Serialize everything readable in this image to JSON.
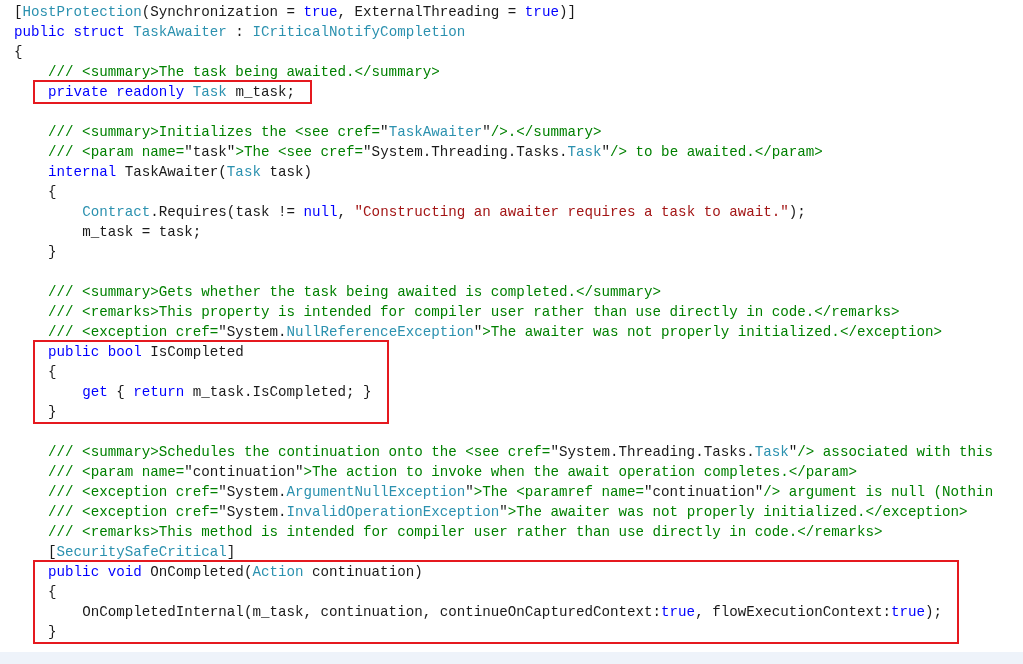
{
  "editor": {
    "blocks": [
      {
        "highlighted": false,
        "blank_line_after": false,
        "lines": [
          [
            {
              "text": "[",
              "kind": "plain"
            },
            {
              "text": "HostProtection",
              "kind": "type"
            },
            {
              "text": "(Synchronization = ",
              "kind": "plain"
            },
            {
              "text": "true",
              "kind": "keyword"
            },
            {
              "text": ", ExternalThreading = ",
              "kind": "plain"
            },
            {
              "text": "true",
              "kind": "keyword"
            },
            {
              "text": ")]",
              "kind": "plain"
            }
          ],
          [
            {
              "text": "public struct ",
              "kind": "keyword"
            },
            {
              "text": "TaskAwaiter",
              "kind": "type"
            },
            {
              "text": " : ",
              "kind": "plain"
            },
            {
              "text": "ICriticalNotifyCompletion",
              "kind": "type"
            }
          ],
          [
            {
              "text": "{",
              "kind": "plain"
            }
          ],
          [
            {
              "text": "    /// <summary>The task being awaited.</summary>",
              "kind": "comment"
            }
          ]
        ]
      },
      {
        "highlighted": true,
        "blank_line_after": true,
        "lines": [
          [
            {
              "text": "    private readonly ",
              "kind": "keyword"
            },
            {
              "text": "Task",
              "kind": "type"
            },
            {
              "text": " m_task;",
              "kind": "plain"
            }
          ]
        ]
      },
      {
        "highlighted": false,
        "blank_line_after": true,
        "lines": [
          [
            {
              "text": "    /// <summary>Initializes the <see cref=",
              "kind": "comment"
            },
            {
              "text": "\"",
              "kind": "plain"
            },
            {
              "text": "TaskAwaiter",
              "kind": "type"
            },
            {
              "text": "\"",
              "kind": "plain"
            },
            {
              "text": "/>.</summary>",
              "kind": "comment"
            }
          ],
          [
            {
              "text": "    /// <param name=",
              "kind": "comment"
            },
            {
              "text": "\"task\"",
              "kind": "plain"
            },
            {
              "text": ">The <see cref=",
              "kind": "comment"
            },
            {
              "text": "\"System.Threading.Tasks.",
              "kind": "plain"
            },
            {
              "text": "Task",
              "kind": "type"
            },
            {
              "text": "\"",
              "kind": "plain"
            },
            {
              "text": "/> to be awaited.</param>",
              "kind": "comment"
            }
          ],
          [
            {
              "text": "    internal ",
              "kind": "keyword"
            },
            {
              "text": "TaskAwaiter(",
              "kind": "plain"
            },
            {
              "text": "Task",
              "kind": "type"
            },
            {
              "text": " task)",
              "kind": "plain"
            }
          ],
          [
            {
              "text": "    {",
              "kind": "plain"
            }
          ],
          [
            {
              "text": "        Contract",
              "kind": "type"
            },
            {
              "text": ".Requires(task != ",
              "kind": "plain"
            },
            {
              "text": "null",
              "kind": "keyword"
            },
            {
              "text": ", ",
              "kind": "plain"
            },
            {
              "text": "\"Constructing an awaiter requires a task to await.\"",
              "kind": "string"
            },
            {
              "text": ");",
              "kind": "plain"
            }
          ],
          [
            {
              "text": "        m_task = task;",
              "kind": "plain"
            }
          ],
          [
            {
              "text": "    }",
              "kind": "plain"
            }
          ]
        ]
      },
      {
        "highlighted": false,
        "blank_line_after": false,
        "lines": [
          [
            {
              "text": "    /// <summary>Gets whether the task being awaited is completed.</summary>",
              "kind": "comment"
            }
          ],
          [
            {
              "text": "    /// <remarks>This property is intended for compiler user rather than use directly in code.</remarks>",
              "kind": "comment"
            }
          ],
          [
            {
              "text": "    /// <exception cref=",
              "kind": "comment"
            },
            {
              "text": "\"System.",
              "kind": "plain"
            },
            {
              "text": "NullReferenceException",
              "kind": "type"
            },
            {
              "text": "\"",
              "kind": "plain"
            },
            {
              "text": ">The awaiter was not properly initialized.</exception>",
              "kind": "comment"
            }
          ]
        ]
      },
      {
        "highlighted": true,
        "blank_line_after": true,
        "lines": [
          [
            {
              "text": "    public bool ",
              "kind": "keyword"
            },
            {
              "text": "IsCompleted",
              "kind": "plain"
            }
          ],
          [
            {
              "text": "    {",
              "kind": "plain"
            }
          ],
          [
            {
              "text": "        get",
              "kind": "keyword"
            },
            {
              "text": " { ",
              "kind": "plain"
            },
            {
              "text": "return",
              "kind": "keyword"
            },
            {
              "text": " m_task.IsCompleted; }",
              "kind": "plain"
            }
          ],
          [
            {
              "text": "    }",
              "kind": "plain"
            }
          ]
        ]
      },
      {
        "highlighted": false,
        "blank_line_after": false,
        "lines": [
          [
            {
              "text": "    /// <summary>Schedules the continuation onto the <see cref=",
              "kind": "comment"
            },
            {
              "text": "\"System.Threading.Tasks.",
              "kind": "plain"
            },
            {
              "text": "Task",
              "kind": "type"
            },
            {
              "text": "\"",
              "kind": "plain"
            },
            {
              "text": "/> associated with this",
              "kind": "comment"
            }
          ],
          [
            {
              "text": "    /// <param name=",
              "kind": "comment"
            },
            {
              "text": "\"continuation\"",
              "kind": "plain"
            },
            {
              "text": ">The action to invoke when the await operation completes.</param>",
              "kind": "comment"
            }
          ],
          [
            {
              "text": "    /// <exception cref=",
              "kind": "comment"
            },
            {
              "text": "\"System.",
              "kind": "plain"
            },
            {
              "text": "ArgumentNullException",
              "kind": "type"
            },
            {
              "text": "\"",
              "kind": "plain"
            },
            {
              "text": ">The <paramref name=",
              "kind": "comment"
            },
            {
              "text": "\"continuation\"",
              "kind": "plain"
            },
            {
              "text": "/> argument is null (Nothin",
              "kind": "comment"
            }
          ],
          [
            {
              "text": "    /// <exception cref=",
              "kind": "comment"
            },
            {
              "text": "\"System.",
              "kind": "plain"
            },
            {
              "text": "InvalidOperationException",
              "kind": "type"
            },
            {
              "text": "\"",
              "kind": "plain"
            },
            {
              "text": ">The awaiter was not properly initialized.</exception>",
              "kind": "comment"
            }
          ],
          [
            {
              "text": "    /// <remarks>This method is intended for compiler user rather than use directly in code.</remarks>",
              "kind": "comment"
            }
          ],
          [
            {
              "text": "    [",
              "kind": "plain"
            },
            {
              "text": "SecuritySafeCritical",
              "kind": "type"
            },
            {
              "text": "]",
              "kind": "plain"
            }
          ]
        ]
      },
      {
        "highlighted": true,
        "blank_line_after": false,
        "lines": [
          [
            {
              "text": "    public void ",
              "kind": "keyword"
            },
            {
              "text": "OnCompleted(",
              "kind": "plain"
            },
            {
              "text": "Action",
              "kind": "type"
            },
            {
              "text": " continuation)",
              "kind": "plain"
            }
          ],
          [
            {
              "text": "    {",
              "kind": "plain"
            }
          ],
          [
            {
              "text": "        OnCompletedInternal(m_task, continuation, continueOnCapturedContext:",
              "kind": "plain"
            },
            {
              "text": "true",
              "kind": "keyword"
            },
            {
              "text": ", flowExecutionContext:",
              "kind": "plain"
            },
            {
              "text": "true",
              "kind": "keyword"
            },
            {
              "text": ");",
              "kind": "plain"
            }
          ],
          [
            {
              "text": "    }",
              "kind": "plain"
            }
          ]
        ]
      }
    ]
  }
}
